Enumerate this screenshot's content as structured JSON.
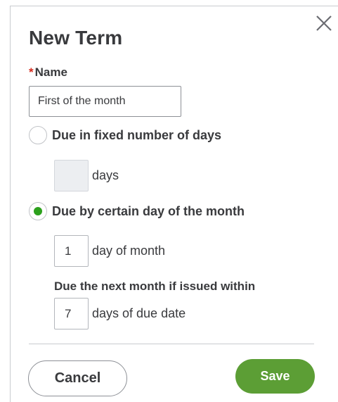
{
  "dialog": {
    "title": "New Term",
    "close_icon": "close-icon"
  },
  "name_field": {
    "required_marker": "*",
    "label": "Name",
    "value": "First of the month"
  },
  "options": {
    "fixed_days": {
      "label": "Due in fixed number of days",
      "selected": false,
      "days_value": "",
      "days_suffix": "days"
    },
    "certain_day": {
      "label": "Due by certain day of the month",
      "selected": true,
      "day_value": "1",
      "day_suffix": "day of month",
      "next_month_heading": "Due the next month if issued within",
      "within_value": "7",
      "within_suffix": "days of due date"
    }
  },
  "buttons": {
    "cancel": "Cancel",
    "save": "Save"
  },
  "colors": {
    "accent_green": "#2ca01c",
    "save_button": "#5c9e35",
    "required_red": "#d52b1e",
    "text": "#393a3d"
  }
}
